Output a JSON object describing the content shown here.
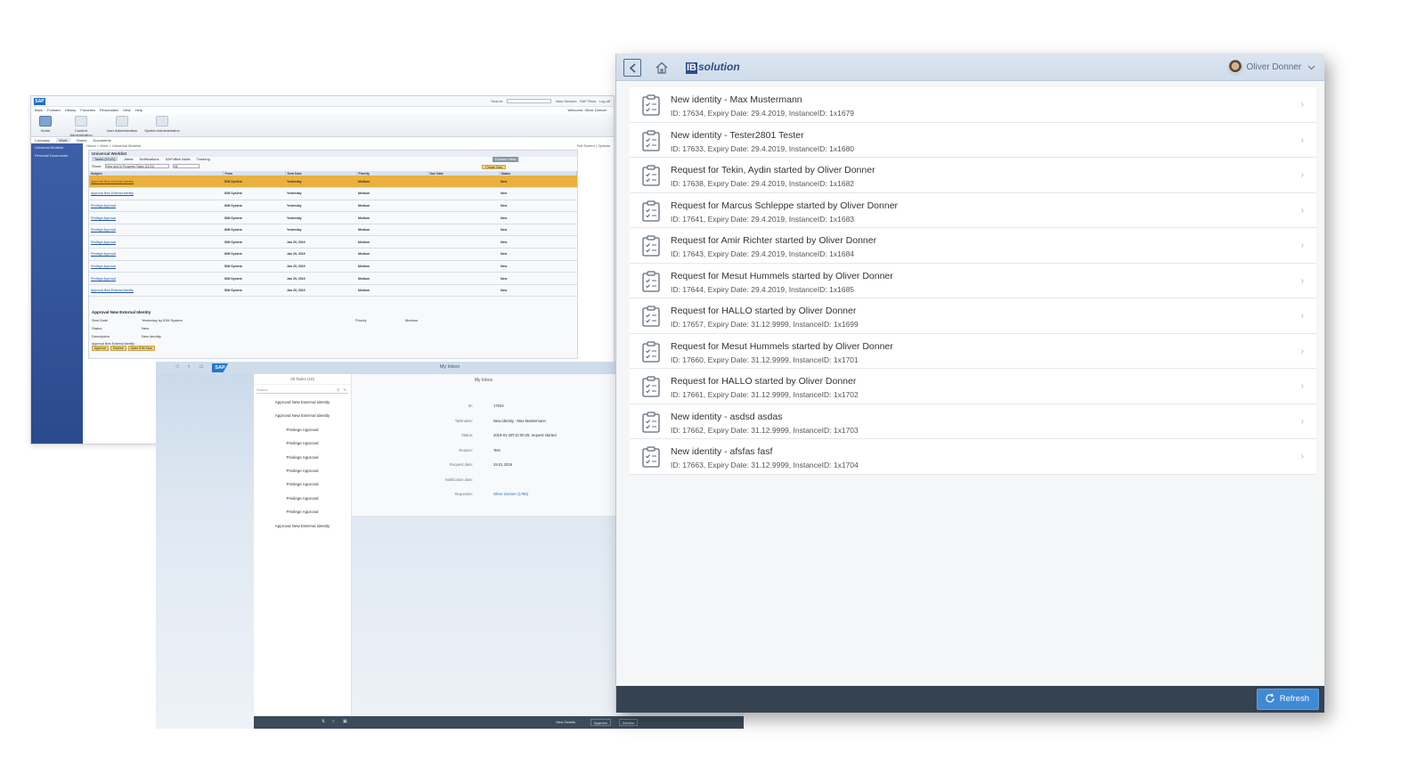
{
  "portal": {
    "logo": "SAP",
    "top_right": {
      "search_label": "Search:",
      "new_session": "New Session",
      "sap_store": "SAP Store",
      "logoff": "Log off"
    },
    "menu": [
      "Back",
      "Forward",
      "History",
      "Favorites",
      "Personalize",
      "View",
      "Help"
    ],
    "welcome": "Welcome: Oliver Donner",
    "launchpad": [
      "Home",
      "Content Administration",
      "User Administration",
      "System Administration"
    ],
    "tabs": [
      "Company",
      "Work",
      "Teams",
      "Documents"
    ],
    "leftnav": [
      "Universal Worklist",
      "Personal Documents"
    ],
    "path": "Home > Work > Universal Worklist",
    "path_right": "Full Screen | Options",
    "uwl": {
      "title": "Universal Worklist",
      "tabs": [
        "Tasks (11/11)",
        "Alerts",
        "Notifications",
        "SAPoffice Mails",
        "Tracking"
      ],
      "customize": "Custom View",
      "show_label": "Show:",
      "show_value": "New and In Progress Tasks (11/11)",
      "show_value2": "All",
      "create_task": "Create Task",
      "columns": [
        "Subject",
        "From",
        "Sent Date",
        "Priority",
        "Due Date",
        "Status"
      ],
      "rows": [
        [
          "Approval New External Identity",
          "IDM System",
          "Yesterday",
          "Medium",
          "",
          "New"
        ],
        [
          "Approval New External Identity",
          "IDM System",
          "Yesterday",
          "Medium",
          "",
          "New"
        ],
        [
          "Privilege Approval",
          "IDM System",
          "Yesterday",
          "Medium",
          "",
          "New"
        ],
        [
          "Privilege Approval",
          "IDM System",
          "Yesterday",
          "Medium",
          "",
          "New"
        ],
        [
          "Privilege Approval",
          "IDM System",
          "Yesterday",
          "Medium",
          "",
          "New"
        ],
        [
          "Privilege Approval",
          "IDM System",
          "Jan 29, 2019",
          "Medium",
          "",
          "New"
        ],
        [
          "Privilege Approval",
          "IDM System",
          "Jan 29, 2019",
          "Medium",
          "",
          "New"
        ],
        [
          "Privilege Approval",
          "IDM System",
          "Jan 29, 2019",
          "Medium",
          "",
          "New"
        ],
        [
          "Privilege Approval",
          "IDM System",
          "Jan 29, 2019",
          "Medium",
          "",
          "New"
        ],
        [
          "Approval New External Identity",
          "IDM System",
          "Jan 29, 2019",
          "Medium",
          "",
          "New"
        ]
      ]
    },
    "detail": {
      "title": "Approval New External Identity",
      "sent_date_label": "Sent Date",
      "sent_date_value": "Yesterday by IDM System",
      "priority_label": "Priority",
      "priority_value": "Medium",
      "status_label": "Status",
      "status_value": "New",
      "description_label": "Description",
      "description_value": "New identity",
      "footer_text": "Approval New External Identity",
      "buttons": [
        "Approve",
        "Decline",
        "Open IDM Task"
      ]
    }
  },
  "fiori": {
    "logo": "SAP",
    "title": "My Inbox",
    "master_header": "All Tasks (10)",
    "search_placeholder": "Search",
    "items": [
      "Approval New External Identity",
      "Approval New External Identity",
      "Privilege Approval",
      "Privilege Approval",
      "Privilege Approval",
      "Privilege Approval",
      "Privilege Approval",
      "Privilege Approval",
      "Privilege Approval",
      "Approval New External Identity"
    ],
    "detail_header": "My Inbox",
    "fields": [
      {
        "k": "ID:",
        "v": "17634"
      },
      {
        "k": "Taskname:",
        "v": "New identity - Max Mustermann"
      },
      {
        "k": "Status:",
        "v": "2019-01-29T12:00:25: request started"
      },
      {
        "k": "Reason:",
        "v": "Test"
      },
      {
        "k": "Request date:",
        "v": "29.01.2019"
      },
      {
        "k": "Notification date:",
        "v": ""
      },
      {
        "k": "Requestor:",
        "v": "Oliver Donner (1766)"
      }
    ],
    "footer": {
      "view_details": "View Details",
      "approve": "Approve",
      "decline": "Decline"
    }
  },
  "app": {
    "logo_prefix": "IB",
    "logo_suffix": "solution",
    "user_name": "Oliver Donner",
    "tasks": [
      {
        "title": "New identity - Max Mustermann",
        "meta": "ID: 17634, Expiry Date: 29.4.2019, InstanceID: 1x1679"
      },
      {
        "title": "New identity - Tester2801 Tester",
        "meta": "ID: 17633, Expiry Date: 29.4.2019, InstanceID: 1x1680"
      },
      {
        "title": "Request for Tekin, Aydin started by Oliver Donner",
        "meta": "ID: 17638, Expiry Date: 29.4.2019, InstanceID: 1x1682"
      },
      {
        "title": "Request for Marcus Schleppe started by Oliver Donner",
        "meta": "ID: 17641, Expiry Date: 29.4.2019, InstanceID: 1x1683"
      },
      {
        "title": "Request for Amir Richter started by Oliver Donner",
        "meta": "ID: 17643, Expiry Date: 29.4.2019, InstanceID: 1x1684"
      },
      {
        "title": "Request for Mesut Hummels started by Oliver Donner",
        "meta": "ID: 17644, Expiry Date: 29.4.2019, InstanceID: 1x1685"
      },
      {
        "title": "Request for HALLO started by Oliver Donner",
        "meta": "ID: 17657, Expiry Date: 31.12.9999, InstanceID: 1x1699"
      },
      {
        "title": "Request for Mesut Hummels started by Oliver Donner",
        "meta": "ID: 17660, Expiry Date: 31.12.9999, InstanceID: 1x1701"
      },
      {
        "title": "Request for HALLO started by Oliver Donner",
        "meta": "ID: 17661, Expiry Date: 31.12.9999, InstanceID: 1x1702"
      },
      {
        "title": "New identity - asdsd asdas",
        "meta": "ID: 17662, Expiry Date: 31.12.9999, InstanceID: 1x1703"
      },
      {
        "title": "New identity - afsfas fasf",
        "meta": "ID: 17663, Expiry Date: 31.12.9999, InstanceID: 1x1704"
      }
    ],
    "refresh_label": "Refresh",
    "colors": {
      "header": "#cfdcea",
      "bottom_bar": "#354250",
      "refresh_button": "#3f8ad6",
      "portal_nav": "#2b4a8d",
      "selected_row": "#eab13e"
    }
  }
}
